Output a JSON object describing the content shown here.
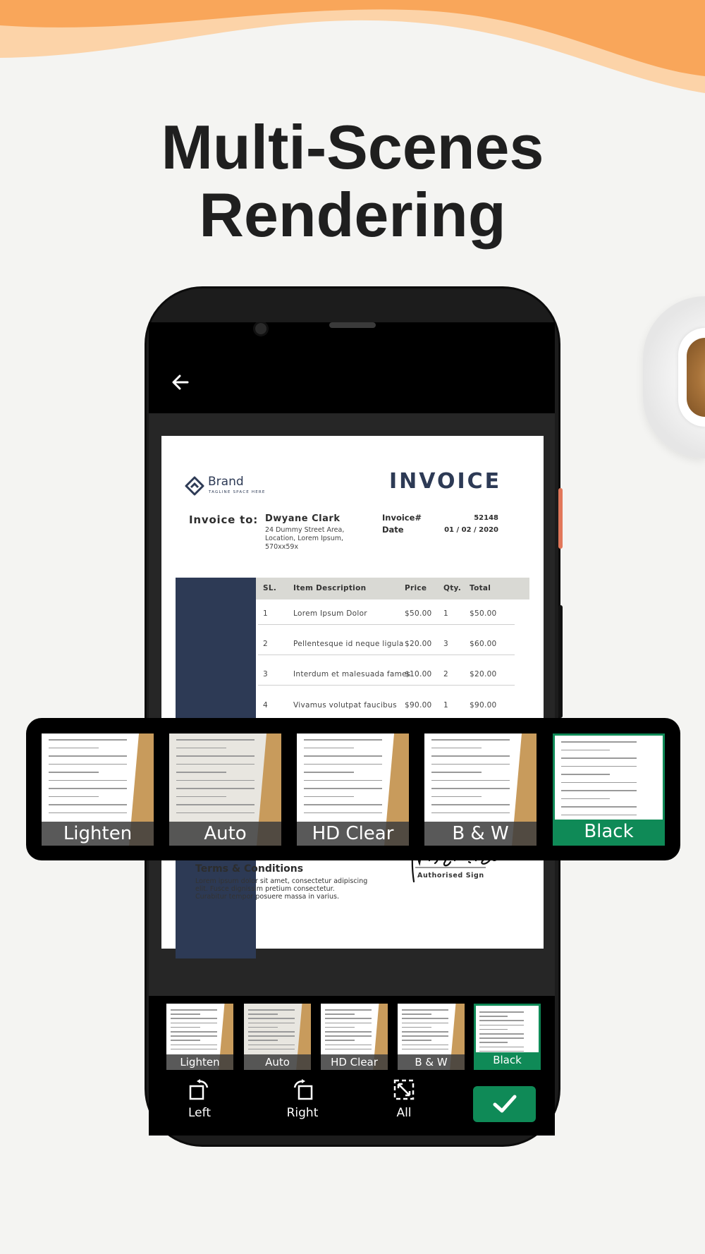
{
  "headline": {
    "line1": "Multi-Scenes",
    "line2": "Rendering"
  },
  "colors": {
    "accent_green": "#0f8a57",
    "wave_orange": "#f9a65a",
    "invoice_navy": "#2d3a55",
    "side_button": "#e2775a"
  },
  "app": {
    "back_icon": "arrow-left-icon"
  },
  "invoice": {
    "brand": "Brand",
    "tagline": "TAGLINE SPACE HERE",
    "title": "INVOICE",
    "to_label": "Invoice to:",
    "client_name": "Dwyane Clark",
    "address": [
      "24 Dummy Street Area,",
      "Location, Lorem Ipsum,",
      "570xx59x"
    ],
    "number_label": "Invoice#",
    "number": "52148",
    "date_label": "Date",
    "date": "01 / 02 / 2020",
    "columns": [
      "SL.",
      "Item Description",
      "Price",
      "Qty.",
      "Total"
    ],
    "rows": [
      [
        "1",
        "Lorem Ipsum Dolor",
        "$50.00",
        "1",
        "$50.00"
      ],
      [
        "2",
        "Pellentesque id neque ligula",
        "$20.00",
        "3",
        "$60.00"
      ],
      [
        "3",
        "Interdum et malesuada fames",
        "$10.00",
        "2",
        "$20.00"
      ],
      [
        "4",
        "Vivamus volutpat faucibus",
        "$90.00",
        "1",
        "$90.00"
      ]
    ],
    "terms_title": "Terms & Conditions",
    "terms_lines": [
      "Lorem ipsum dolor sit amet, consectetur adipiscing",
      "elit. Fusce dignissim pretium consectetur.",
      "Curabitur tempor posuere massa in varius."
    ],
    "signature": "Morgan. Sinclair",
    "sign_label": "Authorised Sign"
  },
  "filters": {
    "items": [
      "Lighten",
      "Auto",
      "HD Clear",
      "B & W",
      "Black"
    ],
    "selected": "Black"
  },
  "toolbar": {
    "left": "Left",
    "right": "Right",
    "all": "All",
    "confirm_icon": "check-icon"
  }
}
